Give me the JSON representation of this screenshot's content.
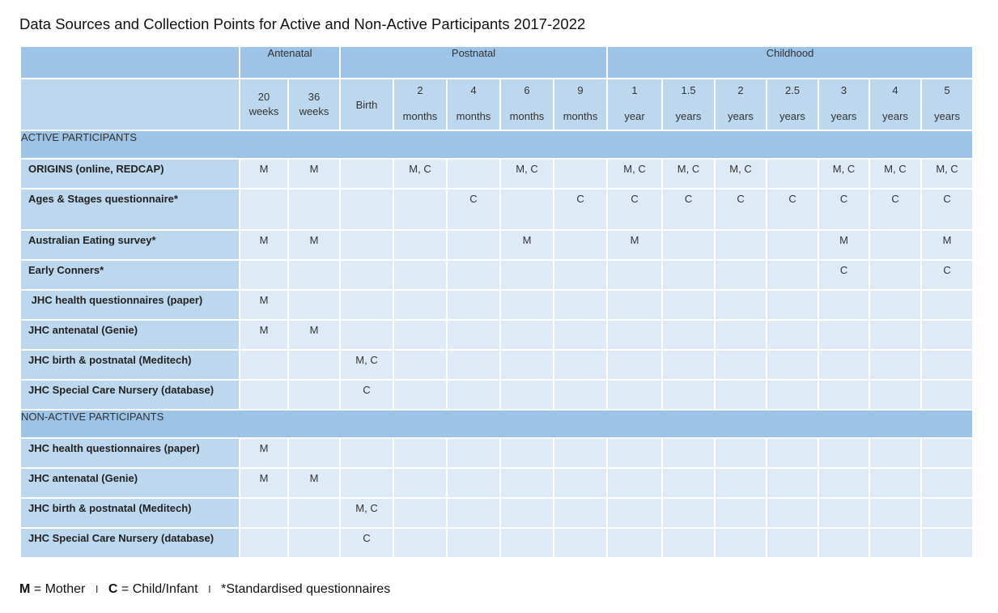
{
  "title": "Data Sources and Collection Points for Active and Non-Active Participants 2017-2022",
  "phases": [
    {
      "label": "",
      "span": 1
    },
    {
      "label": "Antenatal",
      "span": 2
    },
    {
      "label": "Postnatal",
      "span": 5
    },
    {
      "label": "Childhood",
      "span": 7
    }
  ],
  "timepoints": [
    {
      "num": "20",
      "unit": "weeks"
    },
    {
      "num": "36",
      "unit": "weeks"
    },
    {
      "num": "Birth",
      "unit": ""
    },
    {
      "num": "2",
      "unit": "months"
    },
    {
      "num": "4",
      "unit": "months"
    },
    {
      "num": "6",
      "unit": "months"
    },
    {
      "num": "9",
      "unit": "months"
    },
    {
      "num": "1",
      "unit": "year"
    },
    {
      "num": "1.5",
      "unit": "years"
    },
    {
      "num": "2",
      "unit": "years"
    },
    {
      "num": "2.5",
      "unit": "years"
    },
    {
      "num": "3",
      "unit": "years"
    },
    {
      "num": "4",
      "unit": "years"
    },
    {
      "num": "5",
      "unit": "years"
    }
  ],
  "sections": [
    {
      "label": "ACTIVE PARTICIPANTS",
      "rows": [
        {
          "label": "ORIGINS (online, REDCAP)",
          "cells": [
            "M",
            "M",
            "",
            "M, C",
            "",
            "M, C",
            "",
            "M, C",
            "M, C",
            "M, C",
            "",
            "M, C",
            "M, C",
            "M, C"
          ]
        },
        {
          "label": "Ages & Stages questionnaire*",
          "cells": [
            "",
            "",
            "",
            "",
            "C",
            "",
            "C",
            "C",
            "C",
            "C",
            "C",
            "C",
            "C",
            "C"
          ]
        },
        {
          "label": "Australian Eating survey*",
          "cells": [
            "M",
            "M",
            "",
            "",
            "",
            "M",
            "",
            "M",
            "",
            "",
            "",
            "M",
            "",
            "M"
          ]
        },
        {
          "label": "Early Conners*",
          "cells": [
            "",
            "",
            "",
            "",
            "",
            "",
            "",
            "",
            "",
            "",
            "",
            "C",
            "",
            "C"
          ]
        },
        {
          "label": " JHC health questionnaires (paper)",
          "cells": [
            "M",
            "",
            "",
            "",
            "",
            "",
            "",
            "",
            "",
            "",
            "",
            "",
            "",
            ""
          ]
        },
        {
          "label": "JHC antenatal (Genie)",
          "cells": [
            "M",
            "M",
            "",
            "",
            "",
            "",
            "",
            "",
            "",
            "",
            "",
            "",
            "",
            ""
          ]
        },
        {
          "label": "JHC birth & postnatal (Meditech)",
          "cells": [
            "",
            "",
            "M, C",
            "",
            "",
            "",
            "",
            "",
            "",
            "",
            "",
            "",
            "",
            ""
          ]
        },
        {
          "label": "JHC Special Care Nursery (database)",
          "cells": [
            "",
            "",
            "C",
            "",
            "",
            "",
            "",
            "",
            "",
            "",
            "",
            "",
            "",
            ""
          ]
        }
      ]
    },
    {
      "label": "NON-ACTIVE PARTICIPANTS",
      "rows": [
        {
          "label": "JHC health questionnaires (paper)",
          "cells": [
            "M",
            "",
            "",
            "",
            "",
            "",
            "",
            "",
            "",
            "",
            "",
            "",
            "",
            ""
          ]
        },
        {
          "label": "JHC antenatal (Genie)",
          "cells": [
            "M",
            "M",
            "",
            "",
            "",
            "",
            "",
            "",
            "",
            "",
            "",
            "",
            "",
            ""
          ]
        },
        {
          "label": "JHC birth & postnatal (Meditech)",
          "cells": [
            "",
            "",
            "M, C",
            "",
            "",
            "",
            "",
            "",
            "",
            "",
            "",
            "",
            "",
            ""
          ]
        },
        {
          "label": "JHC Special Care Nursery (database)",
          "cells": [
            "",
            "",
            "C",
            "",
            "",
            "",
            "",
            "",
            "",
            "",
            "",
            "",
            "",
            ""
          ]
        }
      ]
    }
  ],
  "legend": {
    "m_key": "M",
    "m_text": " = Mother",
    "c_key": "C",
    "c_text": " = Child/Infant",
    "separator": "I",
    "note": "*Standardised questionnaires"
  },
  "colors": {
    "phase_header": "#9dc3e6",
    "time_header": "#bdd7ee",
    "label_cell": "#bdd7ee",
    "data_cell": "#deeaf6",
    "section_row": "#9dc3e6"
  }
}
